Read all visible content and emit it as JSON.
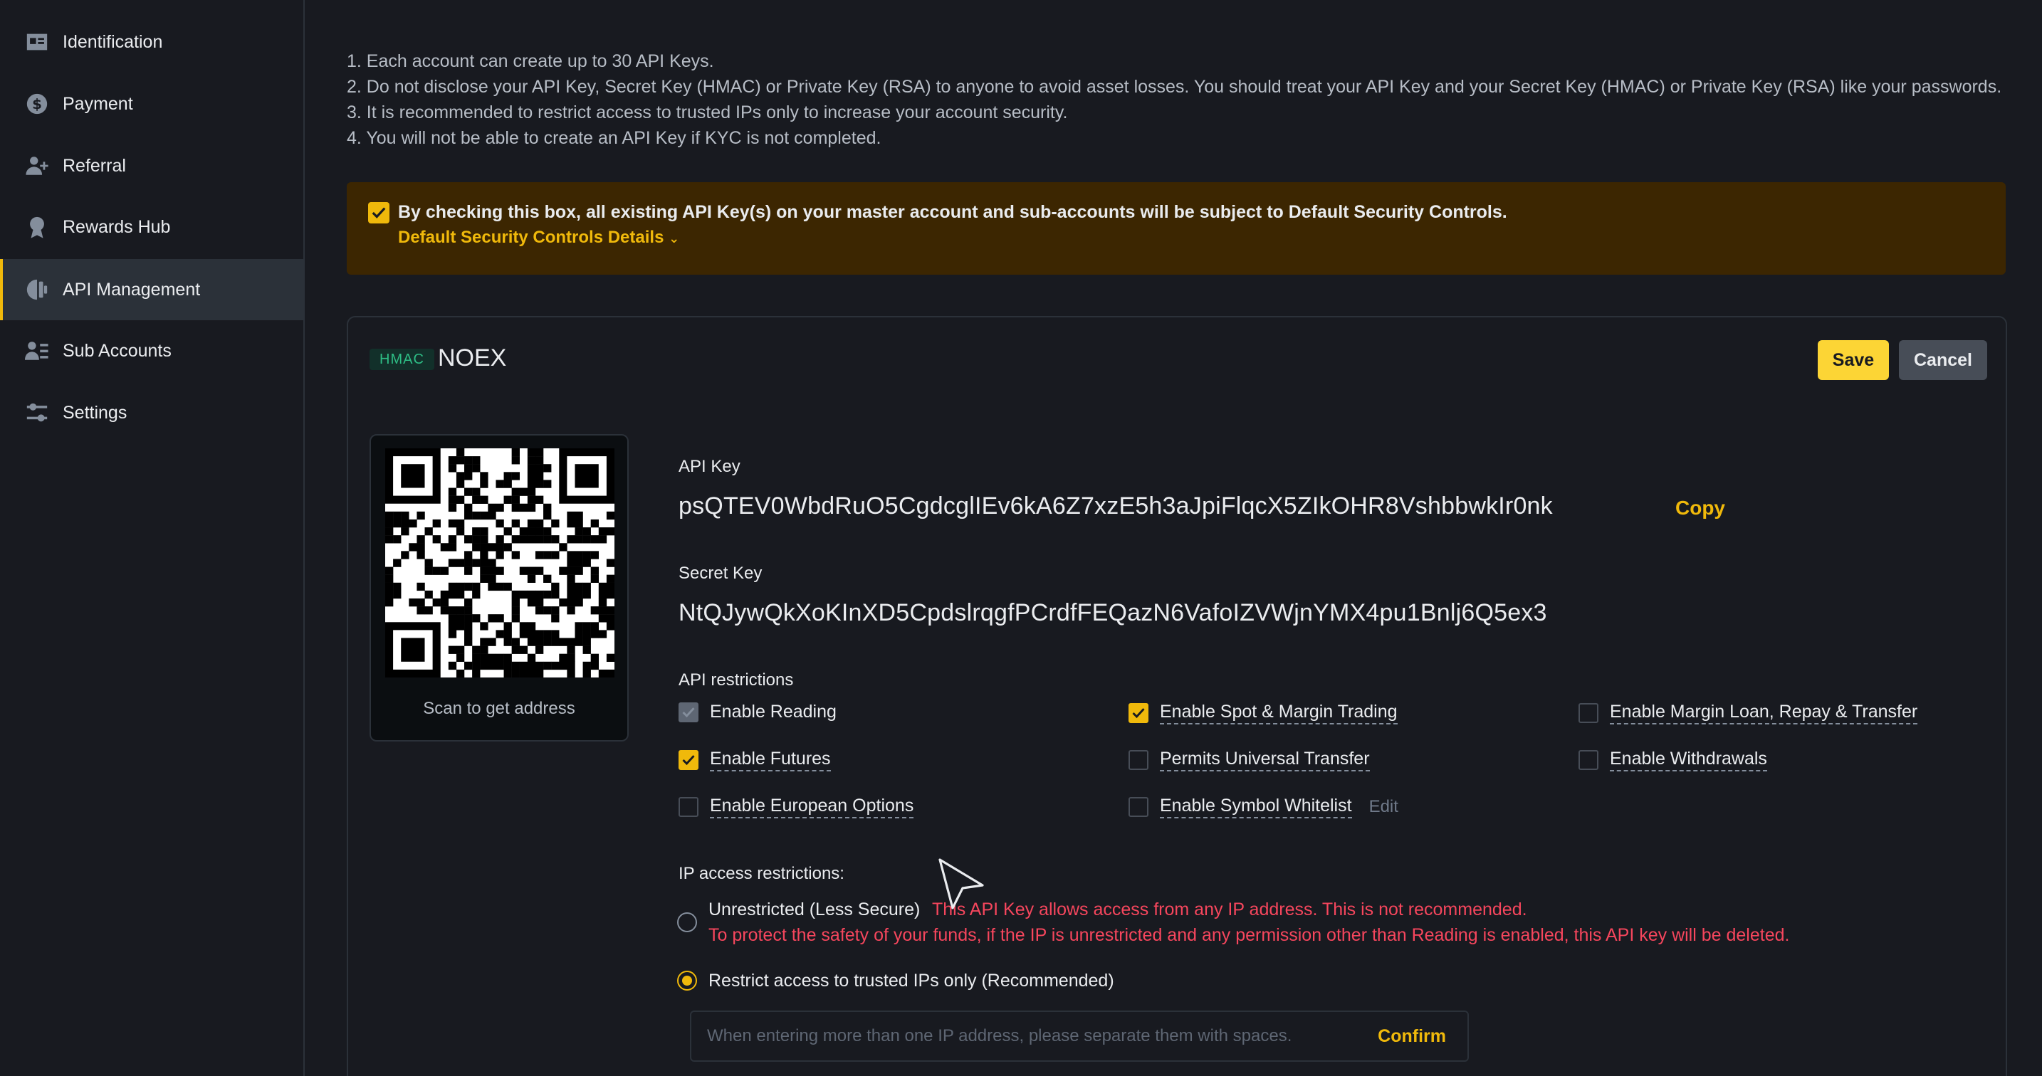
{
  "sidebar": {
    "items": [
      {
        "label": "Identification",
        "icon": "id-card-icon"
      },
      {
        "label": "Payment",
        "icon": "dollar-icon"
      },
      {
        "label": "Referral",
        "icon": "add-user-icon"
      },
      {
        "label": "Rewards Hub",
        "icon": "medal-icon"
      },
      {
        "label": "API Management",
        "icon": "api-icon",
        "active": true
      },
      {
        "label": "Sub Accounts",
        "icon": "sub-accounts-icon"
      },
      {
        "label": "Settings",
        "icon": "sliders-icon"
      }
    ]
  },
  "rules": [
    "1. Each account can create up to 30 API Keys.",
    "2. Do not disclose your API Key, Secret Key (HMAC) or Private Key (RSA) to anyone to avoid asset losses. You should treat your API Key and your Secret Key (HMAC) or Private Key (RSA) like your passwords.",
    "3. It is recommended to restrict access to trusted IPs only to increase your account security.",
    "4. You will not be able to create an API Key if KYC is not completed."
  ],
  "banner": {
    "text": "By checking this box, all existing API Key(s) on your master account and sub-accounts will be subject to Default Security Controls.",
    "link": "Default Security Controls Details",
    "checked": true
  },
  "card": {
    "tag": "HMAC",
    "name": "NOEX",
    "save_label": "Save",
    "cancel_label": "Cancel",
    "qr_caption": "Scan to get address",
    "api_key_label": "API Key",
    "api_key": "psQTEV0WbdRuO5CgdcglIEv6kA6Z7xzE5h3aJpiFlqcX5ZIkOHR8VshbbwkIr0nk",
    "copy_label": "Copy",
    "secret_key_label": "Secret Key",
    "secret_key": "NtQJywQkXoKInXD5CpdslrqgfPCrdfFEQazN6VafoIZVWjnYMX4pu1Bnlj6Q5ex3",
    "restrictions_label": "API restrictions",
    "permissions": [
      {
        "label": "Enable Reading",
        "state": "disabled-checked"
      },
      {
        "label": "Enable Spot & Margin Trading",
        "state": "checked"
      },
      {
        "label": "Enable Margin Loan, Repay & Transfer",
        "state": "unchecked"
      },
      {
        "label": "Enable Futures",
        "state": "checked"
      },
      {
        "label": "Permits Universal Transfer",
        "state": "unchecked"
      },
      {
        "label": "Enable Withdrawals",
        "state": "unchecked"
      },
      {
        "label": "Enable European Options",
        "state": "unchecked"
      },
      {
        "label": "Enable Symbol Whitelist",
        "state": "unchecked"
      }
    ],
    "edit_label": "Edit",
    "ip_label": "IP access restrictions:",
    "unrestricted_label": "Unrestricted (Less Secure)",
    "unrestricted_warning": "This API Key allows access from any IP address. This is not recommended.",
    "unrestricted_warning2": "To protect the safety of your funds, if the IP is unrestricted and any permission other than Reading is enabled, this API key will be deleted.",
    "restricted_label": "Restrict access to trusted IPs only (Recommended)",
    "ip_placeholder": "When entering more than one IP address, please separate them with spaces.",
    "confirm_label": "Confirm"
  },
  "colors": {
    "accent": "#f0b90b",
    "background": "#181a20",
    "warning": "#f6465d",
    "tag_green": "#2ebd85"
  }
}
